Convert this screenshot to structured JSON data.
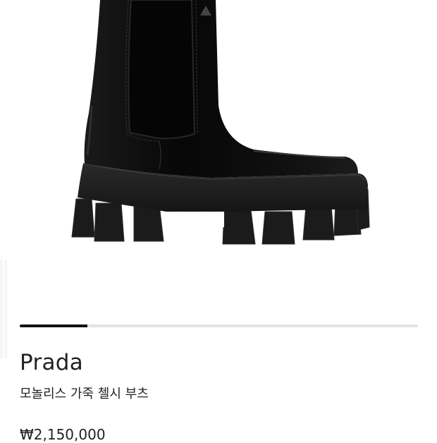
{
  "product": {
    "brand": "Prada",
    "name": "모놀리스 가죽 첼시 부츠",
    "price": "₩2,150,000",
    "image_icon": "chelsea-boot-image"
  },
  "gallery": {
    "progress": 0.17
  },
  "colors": {
    "progress_fill": "#111111",
    "progress_track": "#e3e3e3",
    "boot": "#0d0d0d"
  }
}
